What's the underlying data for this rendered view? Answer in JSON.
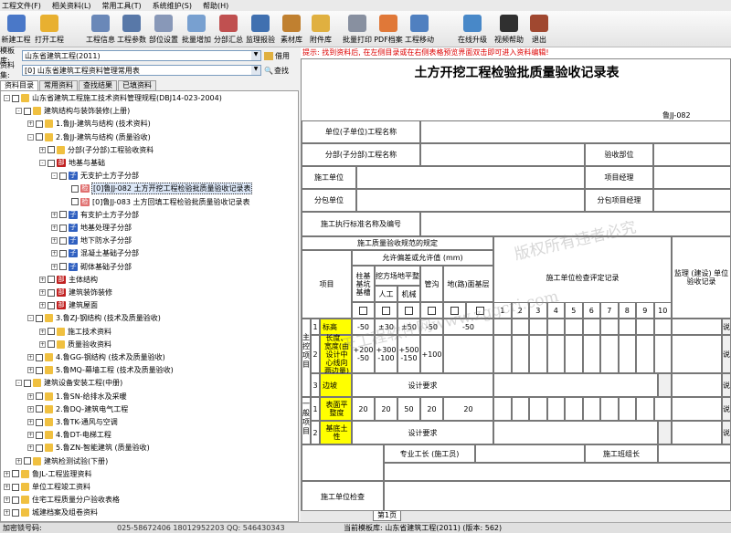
{
  "menu": [
    "工程文件(F)",
    "相关资料(L)",
    "常用工具(T)",
    "系统维护(S)",
    "帮助(H)"
  ],
  "toolbar": [
    {
      "label": "新建工程",
      "icon": "new-project-icon",
      "color": "#4a78c8"
    },
    {
      "label": "打开工程",
      "icon": "open-project-icon",
      "color": "#e8b030"
    },
    {
      "label": "工程信息",
      "icon": "project-info-icon",
      "color": "#6a88b8"
    },
    {
      "label": "工程参数",
      "icon": "project-params-icon",
      "color": "#5878a8"
    },
    {
      "label": "部位设置",
      "icon": "part-settings-icon",
      "color": "#8898b8"
    },
    {
      "label": "批量增加",
      "icon": "batch-add-icon",
      "color": "#78a0d0"
    },
    {
      "label": "分部汇总",
      "icon": "summary-icon",
      "color": "#c05050"
    },
    {
      "label": "监理报验",
      "icon": "supervision-icon",
      "color": "#4070b0"
    },
    {
      "label": "素材库",
      "icon": "material-library-icon",
      "color": "#c08030"
    },
    {
      "label": "附件库",
      "icon": "attachment-icon",
      "color": "#e0b040"
    },
    {
      "label": "批量打印",
      "icon": "print-icon",
      "color": "#8890a0"
    },
    {
      "label": "PDF档案",
      "icon": "pdf-icon",
      "color": "#e07838"
    },
    {
      "label": "工程移动",
      "icon": "move-icon",
      "color": "#5080c0"
    },
    {
      "label": "在线升级",
      "icon": "upgrade-icon",
      "color": "#4888c8"
    },
    {
      "label": "视频帮助",
      "icon": "video-help-icon",
      "color": "#303030"
    },
    {
      "label": "退出",
      "icon": "exit-icon",
      "color": "#a04830"
    }
  ],
  "template_library": {
    "label": "模板库:",
    "value": "山东省建筑工程(2011)",
    "button": "借用"
  },
  "data_set": {
    "label": "资料集:",
    "value": "[0] 山东省建筑工程资料管理常用表",
    "button": "查找"
  },
  "tabs": [
    "资料目录",
    "常用资料",
    "查找结果",
    "已填资料"
  ],
  "tree": [
    {
      "text": "山东省建筑工程施工技术资料管理规程(DBJ14-023-2004)",
      "level": 0,
      "exp": "-",
      "icon": "fold",
      "cb": true
    },
    {
      "text": "建筑结构与装饰装修(上册)",
      "level": 1,
      "exp": "-",
      "icon": "fold",
      "cb": true
    },
    {
      "text": "1.鲁JJ-建筑与结构 (技术资料)",
      "level": 2,
      "exp": "+",
      "icon": "fold",
      "cb": true
    },
    {
      "text": "2.鲁JJ-建筑与结构 (质量验收)",
      "level": 2,
      "exp": "-",
      "icon": "fold",
      "cb": true
    },
    {
      "text": "分部(子分部)工程验收资料",
      "level": 3,
      "exp": "+",
      "icon": "fold",
      "cb": true
    },
    {
      "text": "地基与基础",
      "level": 3,
      "exp": "-",
      "icon": "red",
      "cb": true,
      "tag": "部"
    },
    {
      "text": "无支护土方子分部",
      "level": 4,
      "exp": "-",
      "icon": "blue",
      "cb": true,
      "tag": "子"
    },
    {
      "text": "[0]鲁JJ-082 土方开挖工程检验批质量验收记录表",
      "level": 5,
      "exp": "",
      "icon": "pink",
      "cb": true,
      "tag": "检",
      "selected": true
    },
    {
      "text": "[0]鲁JJ-083 土方回填工程检验批质量验收记录表",
      "level": 5,
      "exp": "",
      "icon": "pink",
      "cb": true,
      "tag": "检"
    },
    {
      "text": "有支护土方子分部",
      "level": 4,
      "exp": "+",
      "icon": "blue",
      "cb": true,
      "tag": "子"
    },
    {
      "text": "地基处理子分部",
      "level": 4,
      "exp": "+",
      "icon": "blue",
      "cb": true,
      "tag": "子"
    },
    {
      "text": "地下防水子分部",
      "level": 4,
      "exp": "+",
      "icon": "blue",
      "cb": true,
      "tag": "子"
    },
    {
      "text": "混凝土基础子分部",
      "level": 4,
      "exp": "+",
      "icon": "blue",
      "cb": true,
      "tag": "子"
    },
    {
      "text": "砌体基础子分部",
      "level": 4,
      "exp": "+",
      "icon": "blue",
      "cb": true,
      "tag": "子"
    },
    {
      "text": "主体结构",
      "level": 3,
      "exp": "+",
      "icon": "red",
      "cb": true,
      "tag": "部"
    },
    {
      "text": "建筑装饰装修",
      "level": 3,
      "exp": "+",
      "icon": "red",
      "cb": true,
      "tag": "部"
    },
    {
      "text": "建筑屋面",
      "level": 3,
      "exp": "+",
      "icon": "red",
      "cb": true,
      "tag": "部"
    },
    {
      "text": "3.鲁ZJ-钢结构 (技术及质量验收)",
      "level": 2,
      "exp": "-",
      "icon": "fold",
      "cb": true
    },
    {
      "text": "施工技术资料",
      "level": 3,
      "exp": "+",
      "icon": "fold",
      "cb": true
    },
    {
      "text": "质量验收资料",
      "level": 3,
      "exp": "+",
      "icon": "fold",
      "cb": true
    },
    {
      "text": "4.鲁GG-钢结构 (技术及质量验收)",
      "level": 2,
      "exp": "+",
      "icon": "fold",
      "cb": true
    },
    {
      "text": "5.鲁MQ-幕墙工程 (技术及质量验收)",
      "level": 2,
      "exp": "+",
      "icon": "fold",
      "cb": true
    },
    {
      "text": "建筑设备安装工程(中册)",
      "level": 1,
      "exp": "-",
      "icon": "fold",
      "cb": true
    },
    {
      "text": "1.鲁SN-给排水及采暖",
      "level": 2,
      "exp": "+",
      "icon": "fold",
      "cb": true
    },
    {
      "text": "2.鲁DQ-建筑电气工程",
      "level": 2,
      "exp": "+",
      "icon": "fold",
      "cb": true
    },
    {
      "text": "3.鲁TK-通风与空调",
      "level": 2,
      "exp": "+",
      "icon": "fold",
      "cb": true
    },
    {
      "text": "4.鲁DT-电梯工程",
      "level": 2,
      "exp": "+",
      "icon": "fold",
      "cb": true
    },
    {
      "text": "5.鲁ZN-智能建筑 (质量验收)",
      "level": 2,
      "exp": "+",
      "icon": "fold",
      "cb": true
    },
    {
      "text": "建筑检测试验(下册)",
      "level": 1,
      "exp": "+",
      "icon": "fold",
      "cb": true
    },
    {
      "text": "鲁JL-工程监理资料",
      "level": 0,
      "exp": "+",
      "icon": "fold",
      "cb": true
    },
    {
      "text": "单位工程竣工资料",
      "level": 0,
      "exp": "+",
      "icon": "fold",
      "cb": true
    },
    {
      "text": "住宅工程质量分户验收表格",
      "level": 0,
      "exp": "+",
      "icon": "fold",
      "cb": true
    },
    {
      "text": "城建档案及组卷资料",
      "level": 0,
      "exp": "+",
      "icon": "fold",
      "cb": true
    }
  ],
  "tip": "提示: 找到资料后, 在左侧目录或在右侧表格预览界面双击即可进入资料编辑!",
  "doc": {
    "title": "土方开挖工程检验批质量验收记录表",
    "code": "鲁JJ-082",
    "unit_name": "单位(子单位)工程名称",
    "sub_name": "分部(子分部)工程名称",
    "accept_part": "验收部位",
    "constructor": "施工单位",
    "pm": "项目经理",
    "subcontractor": "分包单位",
    "sub_pm": "分包项目经理",
    "std": "施工执行标准名称及编号",
    "spec": "施工质量验收规范的规定",
    "allow": "允许偏差或允许值 (mm)",
    "check": "施工单位检查评定记录",
    "supervision": "监理 (建设) 单位验收记录",
    "item": "项目",
    "col_a": "柱基基坑基槽",
    "col_b": "挖方场地平整",
    "col_b1": "人工",
    "col_b2": "机械",
    "col_c": "管沟",
    "col_d": "地(路)面基层",
    "nums": [
      "1",
      "2",
      "3",
      "4",
      "5",
      "6",
      "7",
      "8",
      "9",
      "10"
    ],
    "main": "主控项目",
    "general": "一般项目",
    "rows": [
      {
        "n": "1",
        "name": "标高",
        "a": "-50",
        "b1": "±30",
        "b2": "±50",
        "c": "-50",
        "d": "-50"
      },
      {
        "n": "2",
        "name": "长度、宽度(由设计中心线向两边量)",
        "a": "+200 -50",
        "b1": "+300 -100",
        "b2": "+500 -150",
        "c": "+100",
        "d": ""
      },
      {
        "n": "3",
        "name": "边坡",
        "design": "设计要求"
      },
      {
        "n": "1",
        "name": "表面平整度",
        "a": "20",
        "b1": "20",
        "b2": "50",
        "c": "20",
        "d": "20"
      },
      {
        "n": "2",
        "name": "基底土性",
        "design": "设计要求"
      }
    ],
    "foreman": "专业工长 (施工员)",
    "team": "施工班组长",
    "unit_check": "施工单位检查",
    "side_marks": [
      "说",
      "说",
      "说",
      "说"
    ],
    "watermark1": "天工程软件网www.zggcrj.com",
    "watermark2": "版权所有违者必究",
    "page_tab": "第1页"
  },
  "status": {
    "code_label": "加密锁号码:",
    "phones": "025-58672406  18012952203  QQ: 546430343",
    "current": "当前模板库: 山东省建筑工程(2011) (版本: 562)"
  }
}
